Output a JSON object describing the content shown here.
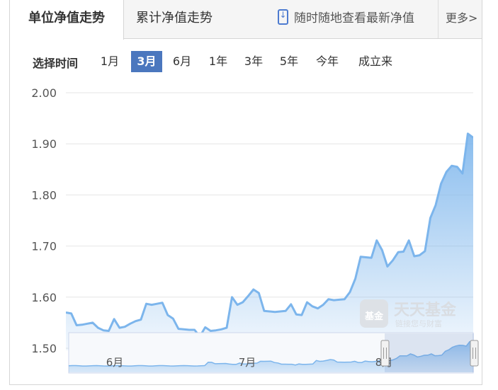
{
  "tabs": {
    "unit_nav": "单位净值走势",
    "accum_nav": "累计净值走势",
    "mobile": "随时随地查看最新净值",
    "more": "更多>"
  },
  "time": {
    "label": "选择时间",
    "ranges": [
      "1月",
      "3月",
      "6月",
      "1年",
      "3年",
      "5年",
      "今年",
      "成立来"
    ],
    "selected": "3月"
  },
  "watermark": {
    "brand": "天天基金",
    "slogan": "链接您与财富",
    "badge": "基金"
  },
  "colors": {
    "line": "#7cb5ec",
    "selected_range": "#4b77be"
  },
  "chart_data": {
    "type": "area",
    "ylim": [
      1.5,
      2.0
    ],
    "yticks": [
      "2.00",
      "1.90",
      "1.80",
      "1.70",
      "1.60",
      "1.50"
    ],
    "grid": true,
    "navigator_labels": [
      "6月",
      "7月",
      "8月"
    ],
    "series": [
      {
        "values": [
          1.57,
          1.568,
          1.545,
          1.546,
          1.548,
          1.55,
          1.54,
          1.535,
          1.534,
          1.557,
          1.54,
          1.542,
          1.548,
          1.553,
          1.556,
          1.587,
          1.585,
          1.587,
          1.589,
          1.565,
          1.558,
          1.538,
          1.537,
          1.536,
          1.536,
          1.523,
          1.541,
          1.534,
          1.535,
          1.537,
          1.54,
          1.6,
          1.585,
          1.59,
          1.602,
          1.615,
          1.608,
          1.573,
          1.572,
          1.571,
          1.572,
          1.573,
          1.586,
          1.566,
          1.565,
          1.59,
          1.582,
          1.578,
          1.585,
          1.596,
          1.594,
          1.595,
          1.596,
          1.61,
          1.636,
          1.679,
          1.678,
          1.677,
          1.711,
          1.692,
          1.66,
          1.672,
          1.688,
          1.689,
          1.711,
          1.68,
          1.682,
          1.69,
          1.755,
          1.78,
          1.822,
          1.845,
          1.857,
          1.855,
          1.842,
          1.92,
          1.912
        ]
      }
    ]
  }
}
